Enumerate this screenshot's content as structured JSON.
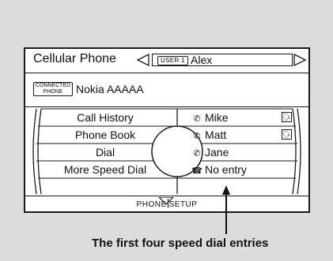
{
  "screen": {
    "title": "Cellular Phone",
    "user_badge": "USER 1",
    "user_name": "Alex",
    "connected_badge_line1": "CONNECTED",
    "connected_badge_line2": "PHONE",
    "device_name": "Nokia AAAAA",
    "menu_items": [
      {
        "label": "Call History"
      },
      {
        "label": "Phone Book"
      },
      {
        "label": "Dial"
      },
      {
        "label": "More Speed Dial"
      }
    ],
    "contacts": [
      {
        "name": "Mike",
        "icon": "cell-phone-icon",
        "has_voice_tag": true
      },
      {
        "name": "Matt",
        "icon": "cell-phone-icon",
        "has_voice_tag": true
      },
      {
        "name": "Jane",
        "icon": "cell-phone-icon",
        "has_voice_tag": false
      },
      {
        "name": "No entry",
        "icon": "home-phone-icon",
        "has_voice_tag": false
      }
    ],
    "footer_left": "PHONE",
    "footer_right": "SETUP"
  },
  "caption": "The first four speed dial entries",
  "colors": {
    "background": "#dcdcdc",
    "screen": "#ffffff",
    "line": "#1a1a1a"
  }
}
